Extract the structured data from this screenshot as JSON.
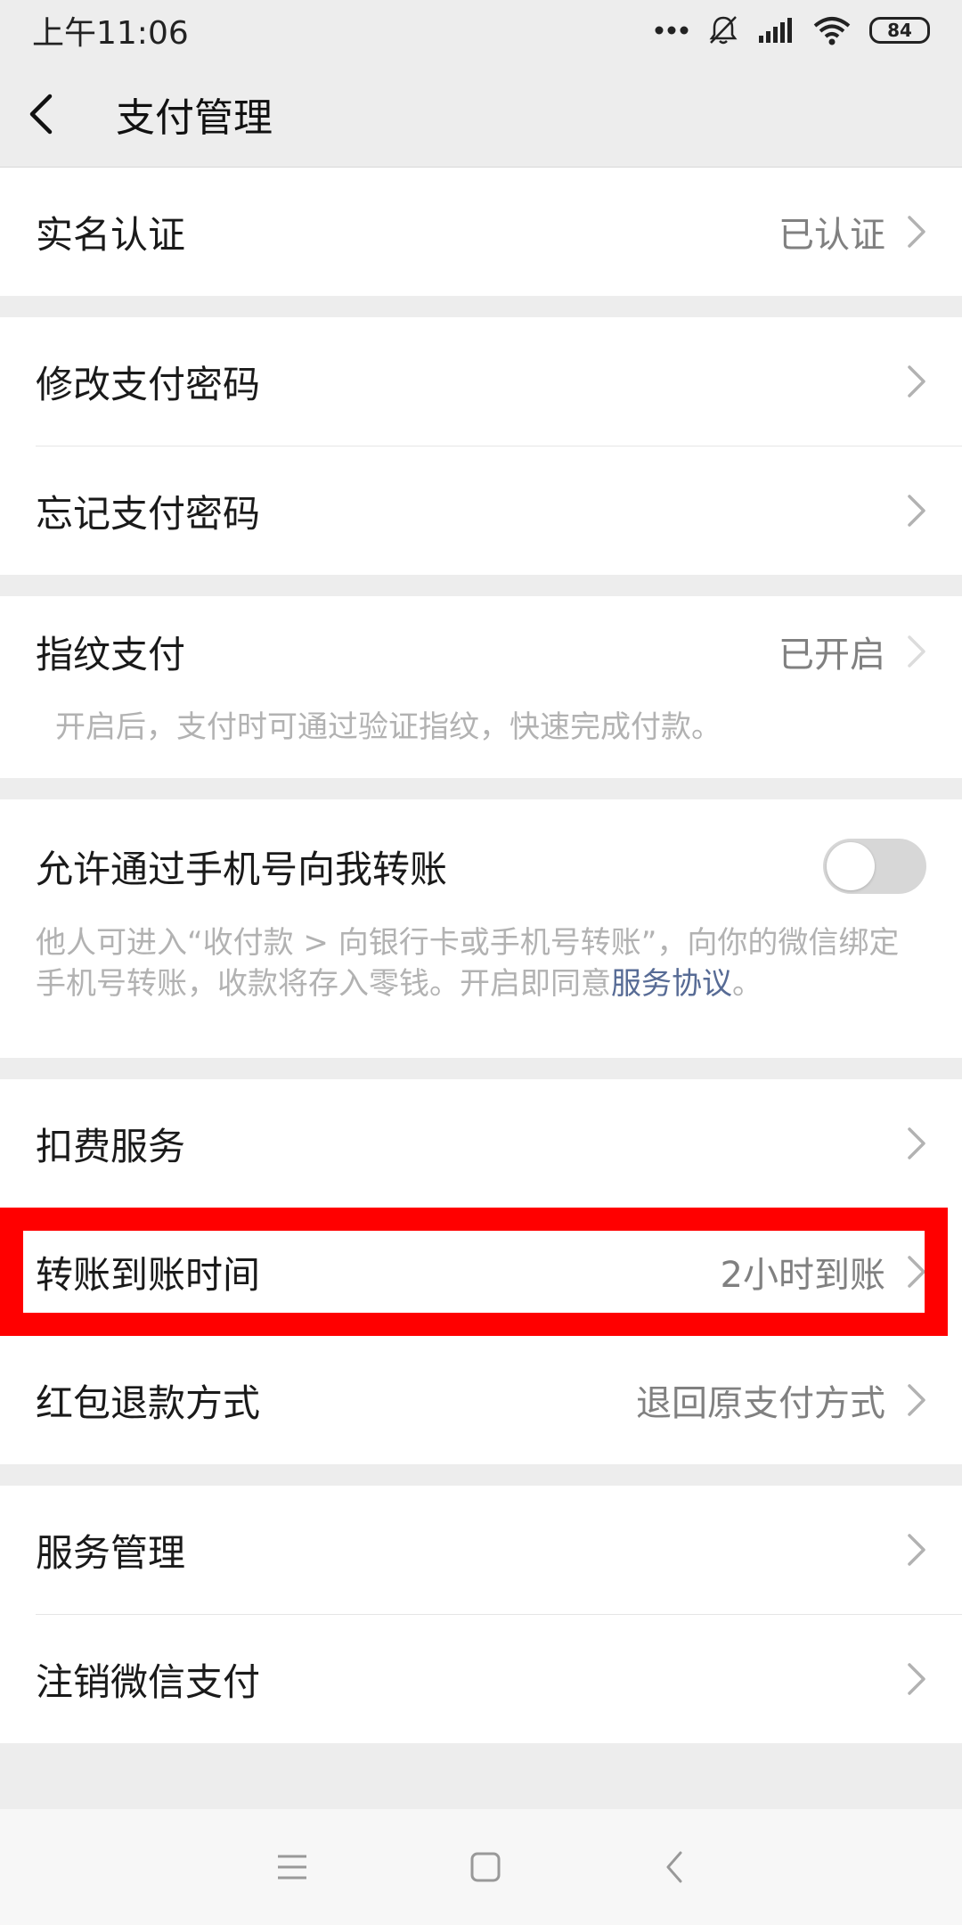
{
  "status_bar": {
    "time": "上午11:06",
    "battery": "84"
  },
  "header": {
    "title": "支付管理"
  },
  "rows": {
    "real_name": {
      "label": "实名认证",
      "value": "已认证"
    },
    "change_pwd": {
      "label": "修改支付密码"
    },
    "forget_pwd": {
      "label": "忘记支付密码"
    },
    "fingerprint": {
      "label": "指纹支付",
      "value": "已开启",
      "desc": "开启后，支付时可通过验证指纹，快速完成付款。"
    },
    "phone_transfer": {
      "label": "允许通过手机号向我转账",
      "desc": "他人可进入“收付款 > 向银行卡或手机号转账”，向你的微信绑定手机号转账，收款将存入零钱。开启即同意",
      "link": "服务协议",
      "desc_end": "。",
      "toggle_on": false
    },
    "deduction": {
      "label": "扣费服务"
    },
    "transfer_time": {
      "label": "转账到账时间",
      "value": "2小时到账"
    },
    "red_packet_refund": {
      "label": "红包退款方式",
      "value": "退回原支付方式"
    },
    "service_mgmt": {
      "label": "服务管理"
    },
    "cancel_wechat_pay": {
      "label": "注销微信支付"
    }
  },
  "colors": {
    "background": "#ededed",
    "link": "#576b95",
    "highlight": "#ff0000"
  }
}
